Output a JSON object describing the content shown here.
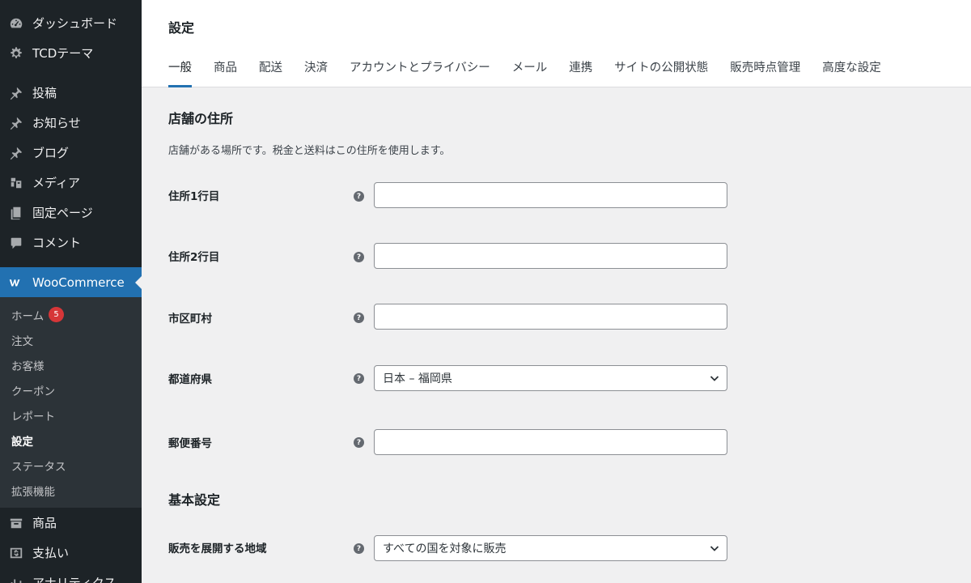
{
  "sidebar": {
    "top_items": [
      {
        "label": "ダッシュボード",
        "icon": "dashboard-icon"
      },
      {
        "label": "TCDテーマ",
        "icon": "gear-icon"
      }
    ],
    "items": [
      {
        "label": "投稿",
        "icon": "pin-icon"
      },
      {
        "label": "お知らせ",
        "icon": "pin-icon"
      },
      {
        "label": "ブログ",
        "icon": "pin-icon"
      },
      {
        "label": "メディア",
        "icon": "media-icon"
      },
      {
        "label": "固定ページ",
        "icon": "page-icon"
      },
      {
        "label": "コメント",
        "icon": "comment-icon"
      }
    ],
    "woocommerce": {
      "label": "WooCommerce",
      "icon": "woocommerce-icon"
    },
    "submenu": [
      {
        "label": "ホーム",
        "badge": "5"
      },
      {
        "label": "注文"
      },
      {
        "label": "お客様"
      },
      {
        "label": "クーポン"
      },
      {
        "label": "レポート"
      },
      {
        "label": "設定"
      },
      {
        "label": "ステータス"
      },
      {
        "label": "拡張機能"
      }
    ],
    "bottom_items": [
      {
        "label": "商品",
        "icon": "archive-icon"
      },
      {
        "label": "支払い",
        "icon": "dollar-icon"
      },
      {
        "label": "アナリティクス",
        "icon": "analytics-icon"
      }
    ]
  },
  "header": {
    "title": "設定",
    "tabs": [
      "一般",
      "商品",
      "配送",
      "決済",
      "アカウントとプライバシー",
      "メール",
      "連携",
      "サイトの公開状態",
      "販売時点管理",
      "高度な設定"
    ]
  },
  "main": {
    "store_address": {
      "title": "店舗の住所",
      "description": "店舗がある場所です。税金と送料はこの住所を使用します。",
      "fields": {
        "address1": {
          "label": "住所1行目",
          "value": ""
        },
        "address2": {
          "label": "住所2行目",
          "value": ""
        },
        "city": {
          "label": "市区町村",
          "value": ""
        },
        "state": {
          "label": "都道府県",
          "value": "日本 – 福岡県"
        },
        "postcode": {
          "label": "郵便番号",
          "value": ""
        }
      }
    },
    "general": {
      "title": "基本設定",
      "selling_location": {
        "label": "販売を展開する地域",
        "value": "すべての国を対象に販売"
      }
    }
  },
  "colors": {
    "accent": "#2271b1",
    "sidebar_bg": "#1d2327",
    "badge": "#d63638"
  }
}
